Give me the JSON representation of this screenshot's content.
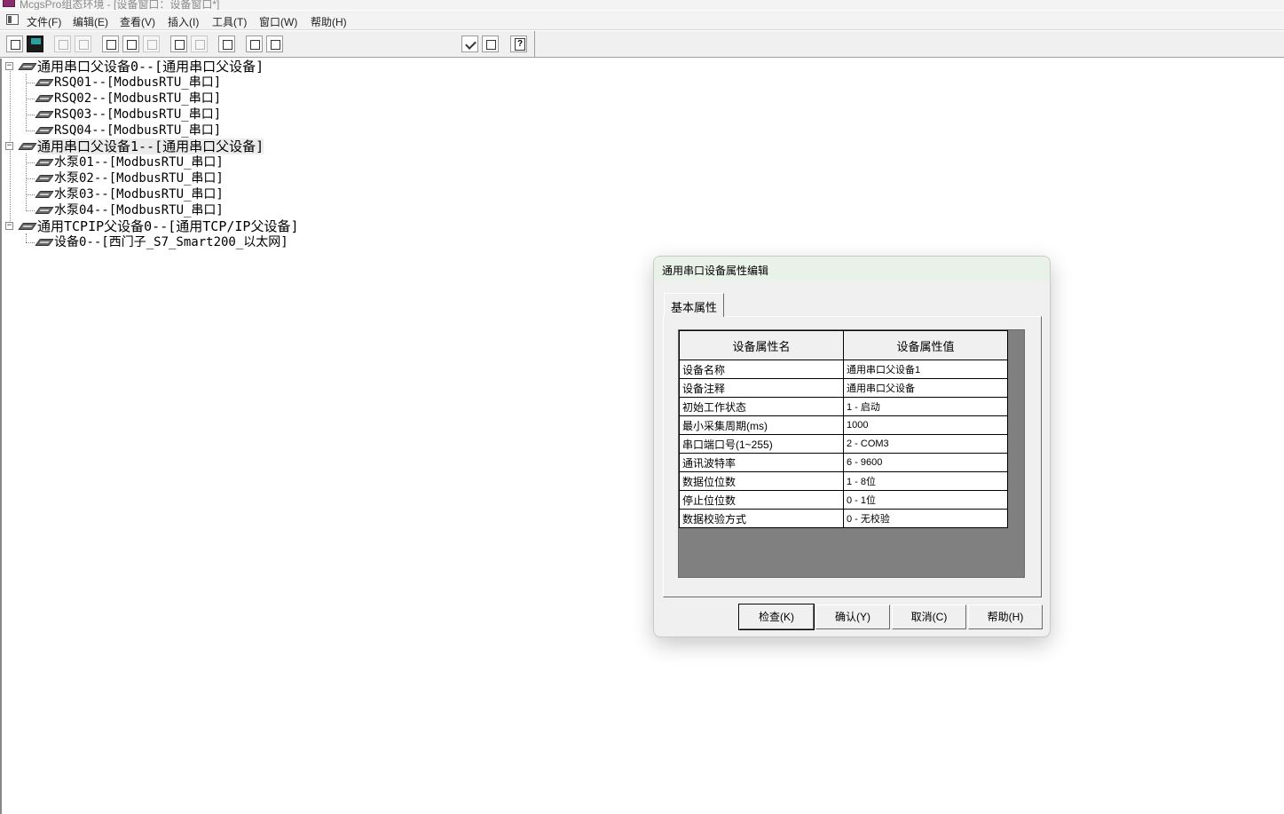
{
  "window": {
    "title": "McgsPro组态环境 - [设备窗口：设备窗口*]"
  },
  "menu": [
    {
      "label": "文件(F)"
    },
    {
      "label": "编辑(E)"
    },
    {
      "label": "查看(V)"
    },
    {
      "label": "插入(I)"
    },
    {
      "label": "工具(T)"
    },
    {
      "label": "窗口(W)"
    },
    {
      "label": "帮助(H)"
    }
  ],
  "toolbar": {
    "icons": [
      "new-window-icon",
      "save-icon",
      "print-icon",
      "print-preview-icon",
      "cut-icon",
      "copy-icon",
      "paste-icon",
      "undo-icon",
      "redo-icon",
      "tools-icon",
      "device-expand-icon",
      "device-collapse-icon",
      "check-icon",
      "properties-icon",
      "help-icon"
    ]
  },
  "tree": [
    {
      "label": "通用串口父设备0--[通用串口父设备]",
      "children": [
        "RSQ01--[ModbusRTU_串口]",
        "RSQ02--[ModbusRTU_串口]",
        "RSQ03--[ModbusRTU_串口]",
        "RSQ04--[ModbusRTU_串口]"
      ]
    },
    {
      "label": "通用串口父设备1--[通用串口父设备]",
      "children": [
        "水泵01--[ModbusRTU_串口]",
        "水泵02--[ModbusRTU_串口]",
        "水泵03--[ModbusRTU_串口]",
        "水泵04--[ModbusRTU_串口]"
      ]
    },
    {
      "label": "通用TCPIP父设备0--[通用TCP/IP父设备]",
      "children": [
        "设备0--[西门子_S7_Smart200_以太网]"
      ]
    }
  ],
  "dialog": {
    "title": "通用串口设备属性编辑",
    "tab": "基本属性",
    "table": {
      "headers": [
        "设备属性名",
        "设备属性值"
      ],
      "rows": [
        [
          "设备名称",
          "通用串口父设备1"
        ],
        [
          "设备注释",
          "通用串口父设备"
        ],
        [
          "初始工作状态",
          "1 - 启动"
        ],
        [
          "最小采集周期(ms)",
          "1000"
        ],
        [
          "串口端口号(1~255)",
          "2 - COM3"
        ],
        [
          "通讯波特率",
          "6 - 9600"
        ],
        [
          "数据位位数",
          "1 - 8位"
        ],
        [
          "停止位位数",
          "0 - 1位"
        ],
        [
          "数据校验方式",
          "0 - 无校验"
        ]
      ]
    },
    "buttons": {
      "check": "检查(K)",
      "confirm": "确认(Y)",
      "cancel": "取消(C)",
      "help": "帮助(H)"
    }
  }
}
